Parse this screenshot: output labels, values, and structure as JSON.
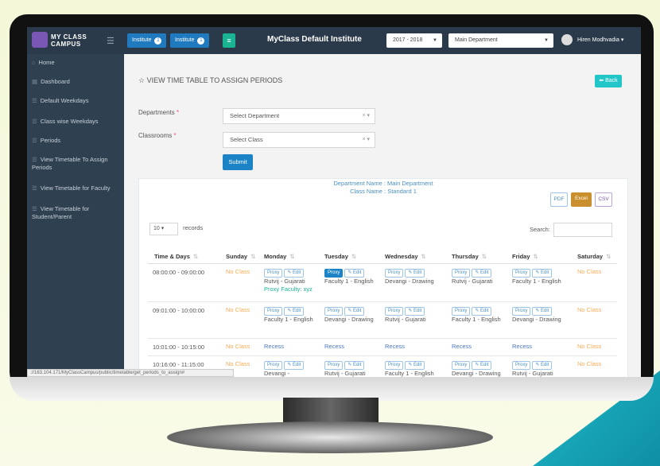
{
  "brand": {
    "line1": "MY CLASS",
    "line2": "CAMPUS"
  },
  "top": {
    "institute_buttons": [
      {
        "label": "Institute",
        "badge": "1"
      },
      {
        "label": "Institute",
        "badge": "1"
      }
    ],
    "institute_title": "MyClass Default Institute",
    "year_value": "2017 - 2018",
    "department_value": "Main Department",
    "user_name": "Hiren Modhvadia"
  },
  "sidebar": {
    "items": [
      "Home",
      "Dashboard",
      "Default Weekdays",
      "Class wise Weekdays",
      "Periods",
      "View Timetable To Assign Periods",
      "View Timetable for Faculty",
      "View Timetable for Student/Parent"
    ]
  },
  "page": {
    "title": "VIEW TIME TABLE TO ASSIGN PERIODS",
    "back_label": "Back"
  },
  "form": {
    "departments_label": "Departments",
    "classrooms_label": "Classrooms",
    "department_select": "Select Department",
    "class_select": "Select Class",
    "submit_label": "Submit"
  },
  "info": {
    "department_name": "Department Name : Main Department",
    "class_name": "Class Name : Standard 1"
  },
  "export": {
    "pdf": "PDF",
    "excel": "Excel",
    "csv": "CSV"
  },
  "table_controls": {
    "records_value": "10",
    "records_label": "records",
    "search_label": "Search:"
  },
  "table": {
    "columns": [
      "Time & Days",
      "Sunday",
      "Monday",
      "Tuesday",
      "Wednesday",
      "Thursday",
      "Friday",
      "Saturday"
    ],
    "proxy_label": "Proxy",
    "edit_label": "Edit",
    "no_class": "No Class",
    "rows": [
      {
        "time": "08:00:00 - 09:00:00",
        "monday": "Rutvij - Gujarati",
        "monday_proxy": "Proxy Faculty: xyz",
        "tuesday": "Faculty 1 - English",
        "wednesday": "Devangi - Drawing",
        "thursday": "Rutvij - Gujarati",
        "friday": "Faculty 1 - English"
      },
      {
        "time": "09:01:00 - 10:00:00",
        "monday": "Faculty 1 - English",
        "tuesday": "Devangi - Drawing",
        "wednesday": "Rutvij - Gujarati",
        "thursday": "Faculty 1 - English",
        "friday": "Devangi - Drawing"
      },
      {
        "time": "10:01:00 - 10:15:00",
        "monday": "Recess",
        "tuesday": "Recess",
        "wednesday": "Recess",
        "thursday": "Recess",
        "friday": "Recess"
      },
      {
        "time": "10:16:00 - 11:15:00",
        "monday": "Devangi -",
        "tuesday": "Rutvij - Gujarati",
        "wednesday": "Faculty 1 - English",
        "thursday": "Devangi - Drawing",
        "friday": "Rutvij - Gujarati"
      }
    ]
  },
  "status_url": "://163.104.171/MyClassCampus/public/timetable/get_periods_to_assign#"
}
